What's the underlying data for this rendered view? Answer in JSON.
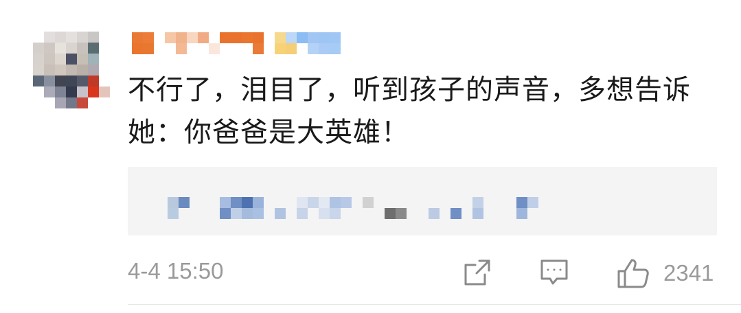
{
  "comment": {
    "text": "不行了，泪目了，听到孩子的声音，多想告诉她：你爸爸是大英雄！",
    "timestamp": "4-4 15:50",
    "like_count": "2341"
  },
  "icons": {
    "share": "share-icon",
    "reply": "comment-icon",
    "like": "thumbs-up-icon"
  },
  "colors": {
    "text": "#1a1a1a",
    "meta": "#9a9a9a",
    "quote_bg": "#f4f4f4"
  }
}
